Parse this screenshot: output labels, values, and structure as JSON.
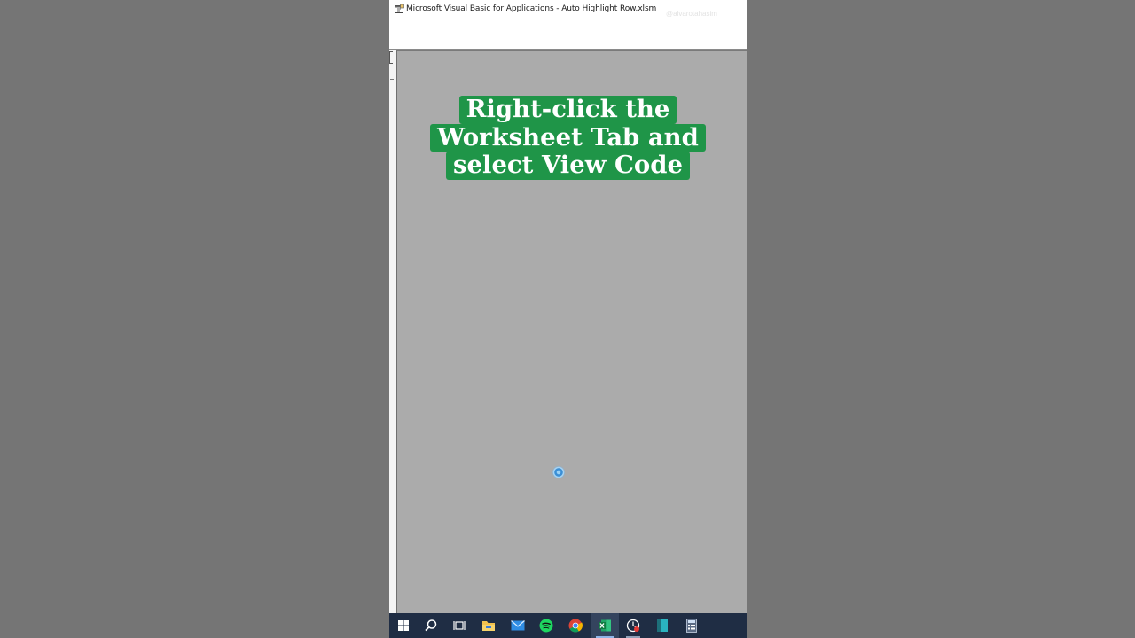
{
  "window": {
    "title": "Microsoft Visual Basic for Applications - Auto Highlight Row.xlsm",
    "watermark": "@alvarotahasim"
  },
  "overlay": {
    "caption_lines": [
      "Right-click the",
      "Worksheet Tab and",
      "select View Code"
    ],
    "caption_color": "#1f9548"
  },
  "taskbar": {
    "items": [
      {
        "name": "windows-start-icon"
      },
      {
        "name": "search-icon"
      },
      {
        "name": "task-view-icon"
      },
      {
        "name": "file-explorer-icon"
      },
      {
        "name": "mail-icon"
      },
      {
        "name": "spotify-icon"
      },
      {
        "name": "chrome-icon"
      },
      {
        "name": "excel-icon",
        "active": true
      },
      {
        "name": "screen-recorder-icon"
      },
      {
        "name": "app-icon"
      },
      {
        "name": "calculator-icon"
      }
    ]
  }
}
